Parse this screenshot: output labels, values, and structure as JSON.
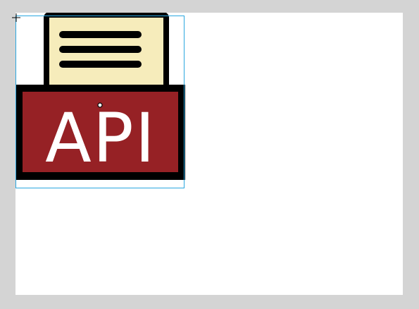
{
  "canvas": {
    "background": "#d4d4d4",
    "artboard_color": "#ffffff",
    "selection_color": "#2aa7e0"
  },
  "graphic": {
    "icon": "api-document-icon",
    "label": "API",
    "colors": {
      "outline": "#000000",
      "paper": "#f6ecbb",
      "panel": "#962125",
      "text": "#ffffff"
    }
  },
  "tools": {
    "crosshair_icon": "crosshair-icon",
    "center_handle_icon": "center-point-handle"
  }
}
